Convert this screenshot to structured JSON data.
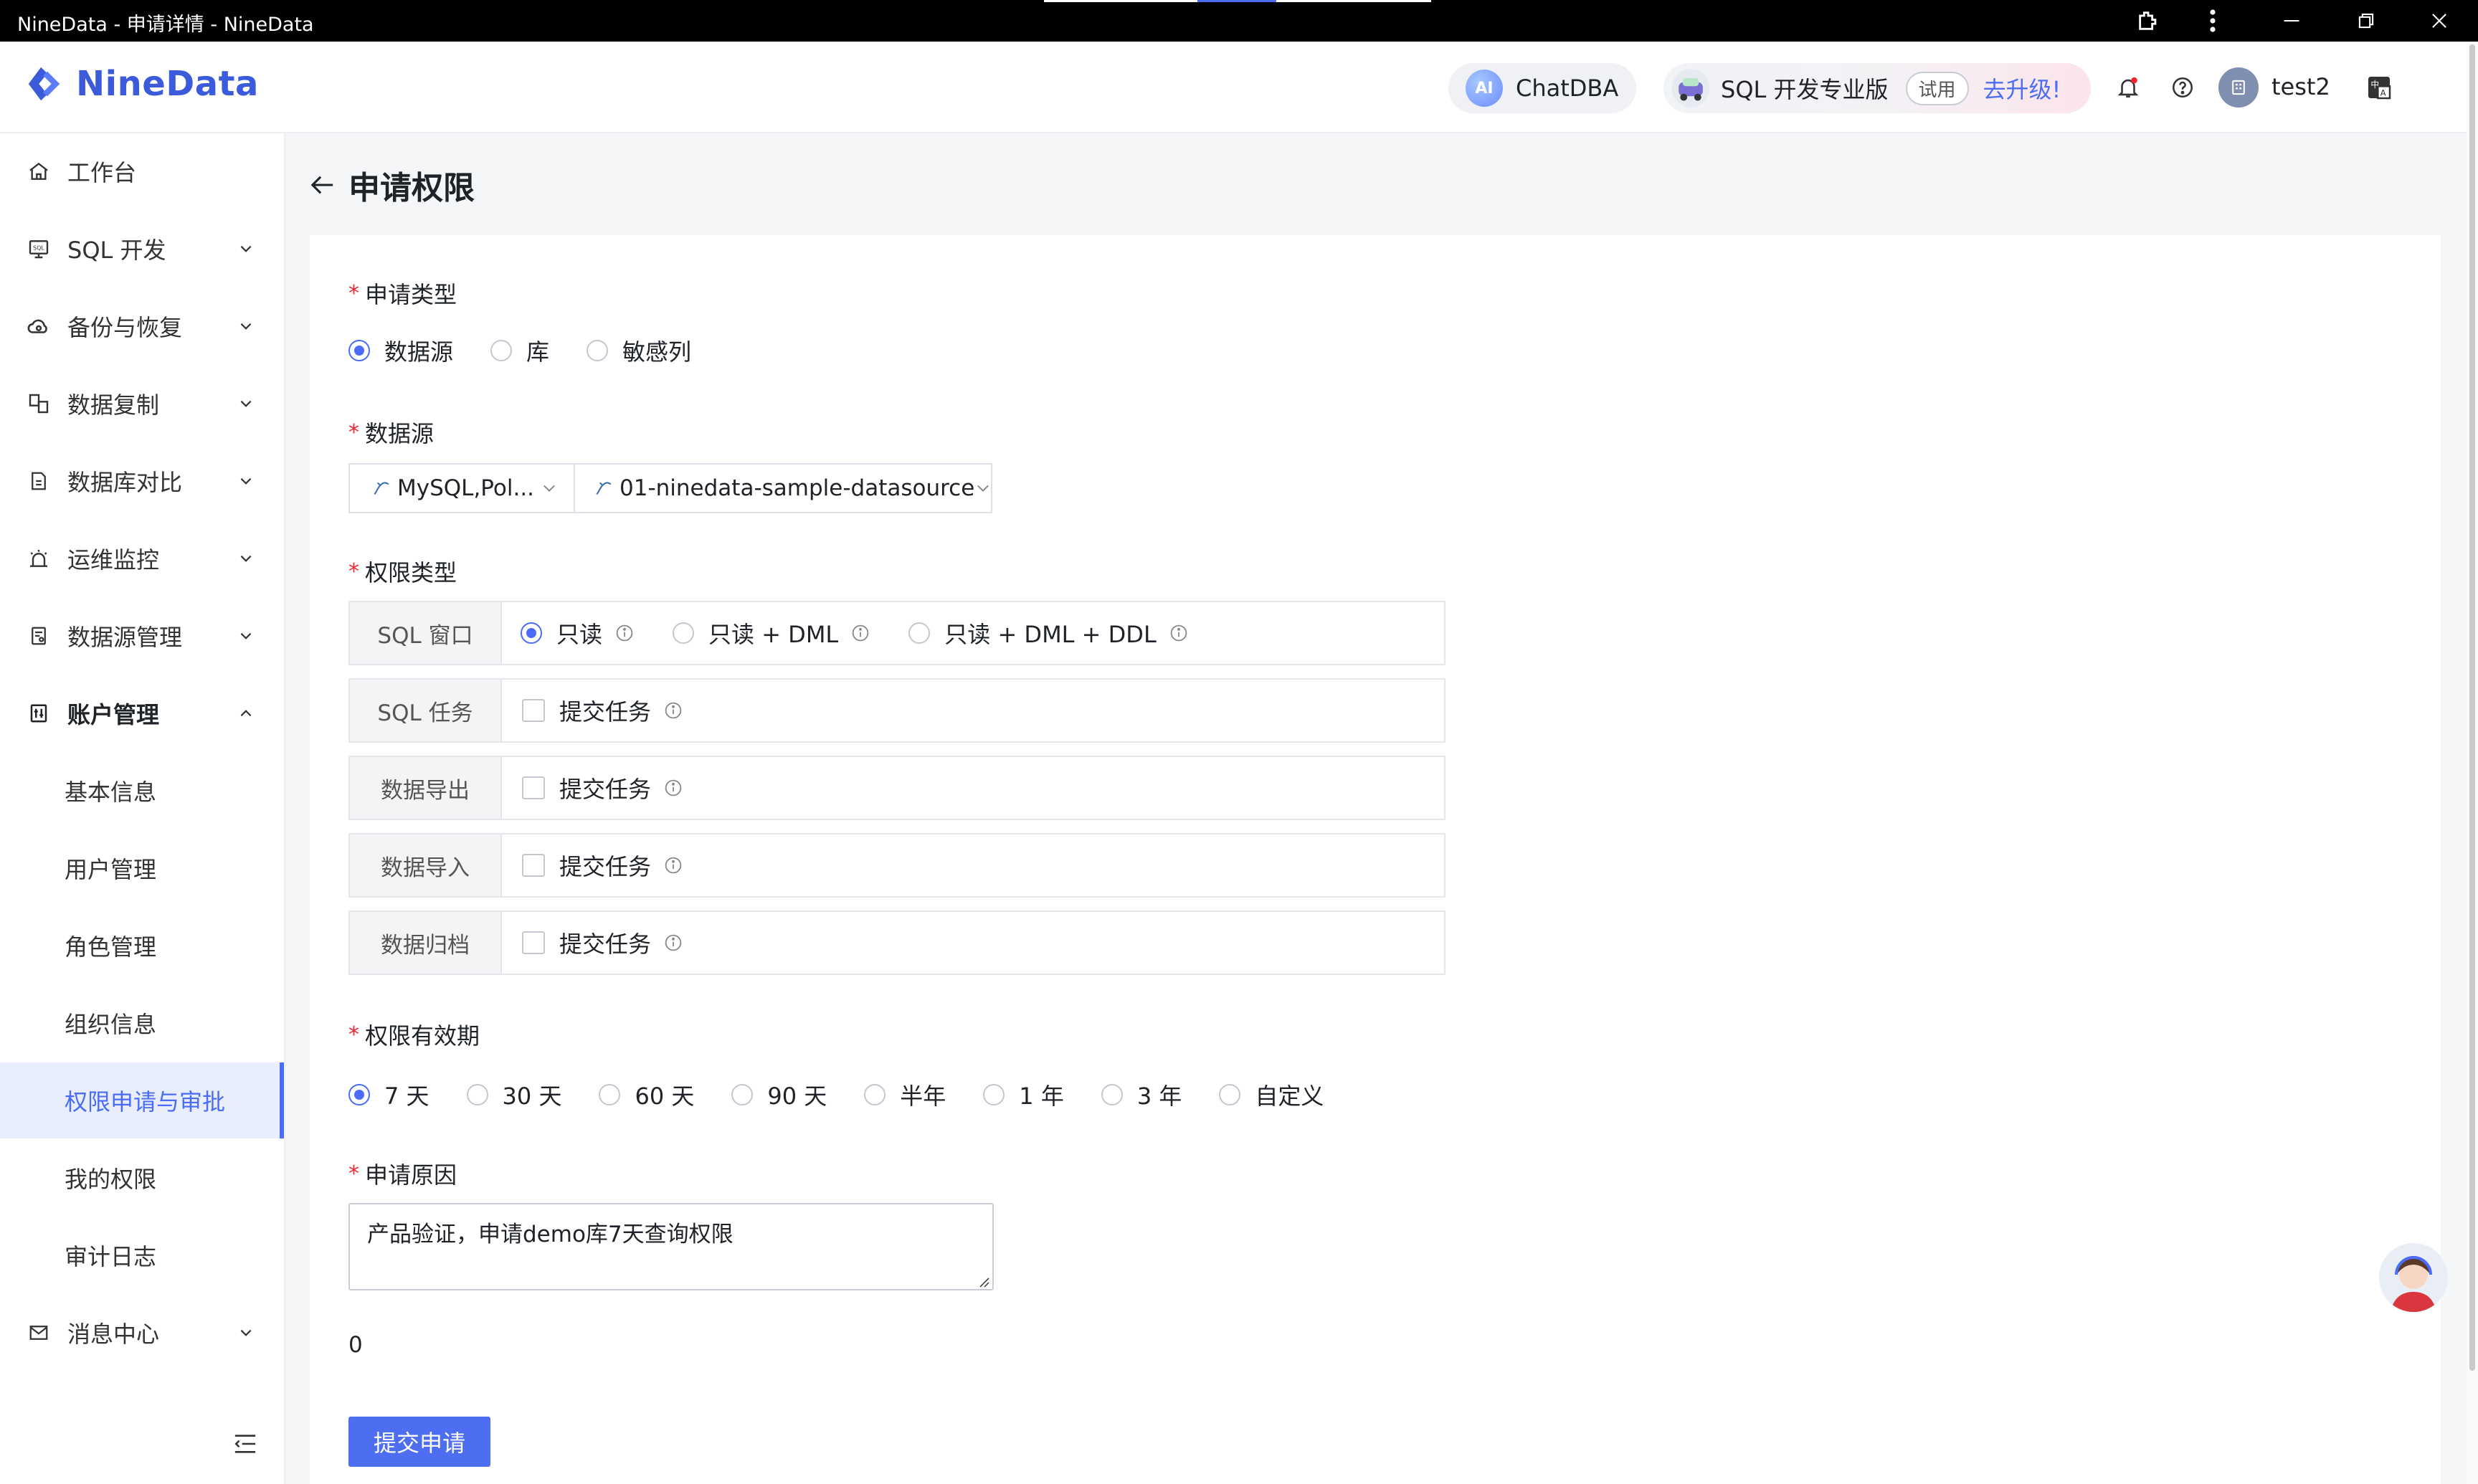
{
  "window": {
    "title": "NineData - 申请详情 - NineData"
  },
  "header": {
    "logo_text": "NineData",
    "chat_label": "ChatDBA",
    "chat_icon_text": "AI",
    "sql_edition": "SQL 开发专业版",
    "trial_badge": "试用",
    "upgrade_link": "去升级!",
    "username": "test2",
    "colors": {
      "accent": "#4a6cf7",
      "notification_dot": "#f5222d"
    }
  },
  "sidebar": {
    "items": [
      {
        "label": "工作台",
        "icon": "home-icon"
      },
      {
        "label": "SQL 开发",
        "icon": "sql-console-icon"
      },
      {
        "label": "备份与恢复",
        "icon": "cloud-backup-icon"
      },
      {
        "label": "数据复制",
        "icon": "replication-icon"
      },
      {
        "label": "数据库对比",
        "icon": "compare-icon"
      },
      {
        "label": "运维监控",
        "icon": "alarm-icon"
      },
      {
        "label": "数据源管理",
        "icon": "datasource-icon"
      },
      {
        "label": "账户管理",
        "icon": "account-icon"
      },
      {
        "label": "消息中心",
        "icon": "mail-icon"
      }
    ],
    "account_sub": [
      "基本信息",
      "用户管理",
      "角色管理",
      "组织信息",
      "权限申请与审批",
      "我的权限",
      "审计日志"
    ],
    "active_sub": "权限申请与审批"
  },
  "page": {
    "title": "申请权限",
    "request_type": {
      "label": "申请类型",
      "options": [
        "数据源",
        "库",
        "敏感列"
      ],
      "selected": "数据源"
    },
    "datasource": {
      "label": "数据源",
      "type_select": "MySQL,Pol...",
      "source_select": "01-ninedata-sample-datasource"
    },
    "permission_type": {
      "label": "权限类型",
      "rows": [
        {
          "name": "SQL 窗口",
          "options": [
            "只读",
            "只读 + DML",
            "只读 + DML + DDL"
          ],
          "selected": "只读"
        },
        {
          "name": "SQL 任务",
          "checkbox": "提交任务"
        },
        {
          "name": "数据导出",
          "checkbox": "提交任务"
        },
        {
          "name": "数据导入",
          "checkbox": "提交任务"
        },
        {
          "name": "数据归档",
          "checkbox": "提交任务"
        }
      ]
    },
    "validity": {
      "label": "权限有效期",
      "options": [
        "7 天",
        "30 天",
        "60 天",
        "90 天",
        "半年",
        "1 年",
        "3 年",
        "自定义"
      ],
      "selected": "7 天"
    },
    "reason": {
      "label": "申请原因",
      "value": "产品验证，申请demo库7天查询权限",
      "counter": "0"
    },
    "submit_label": "提交申请"
  }
}
